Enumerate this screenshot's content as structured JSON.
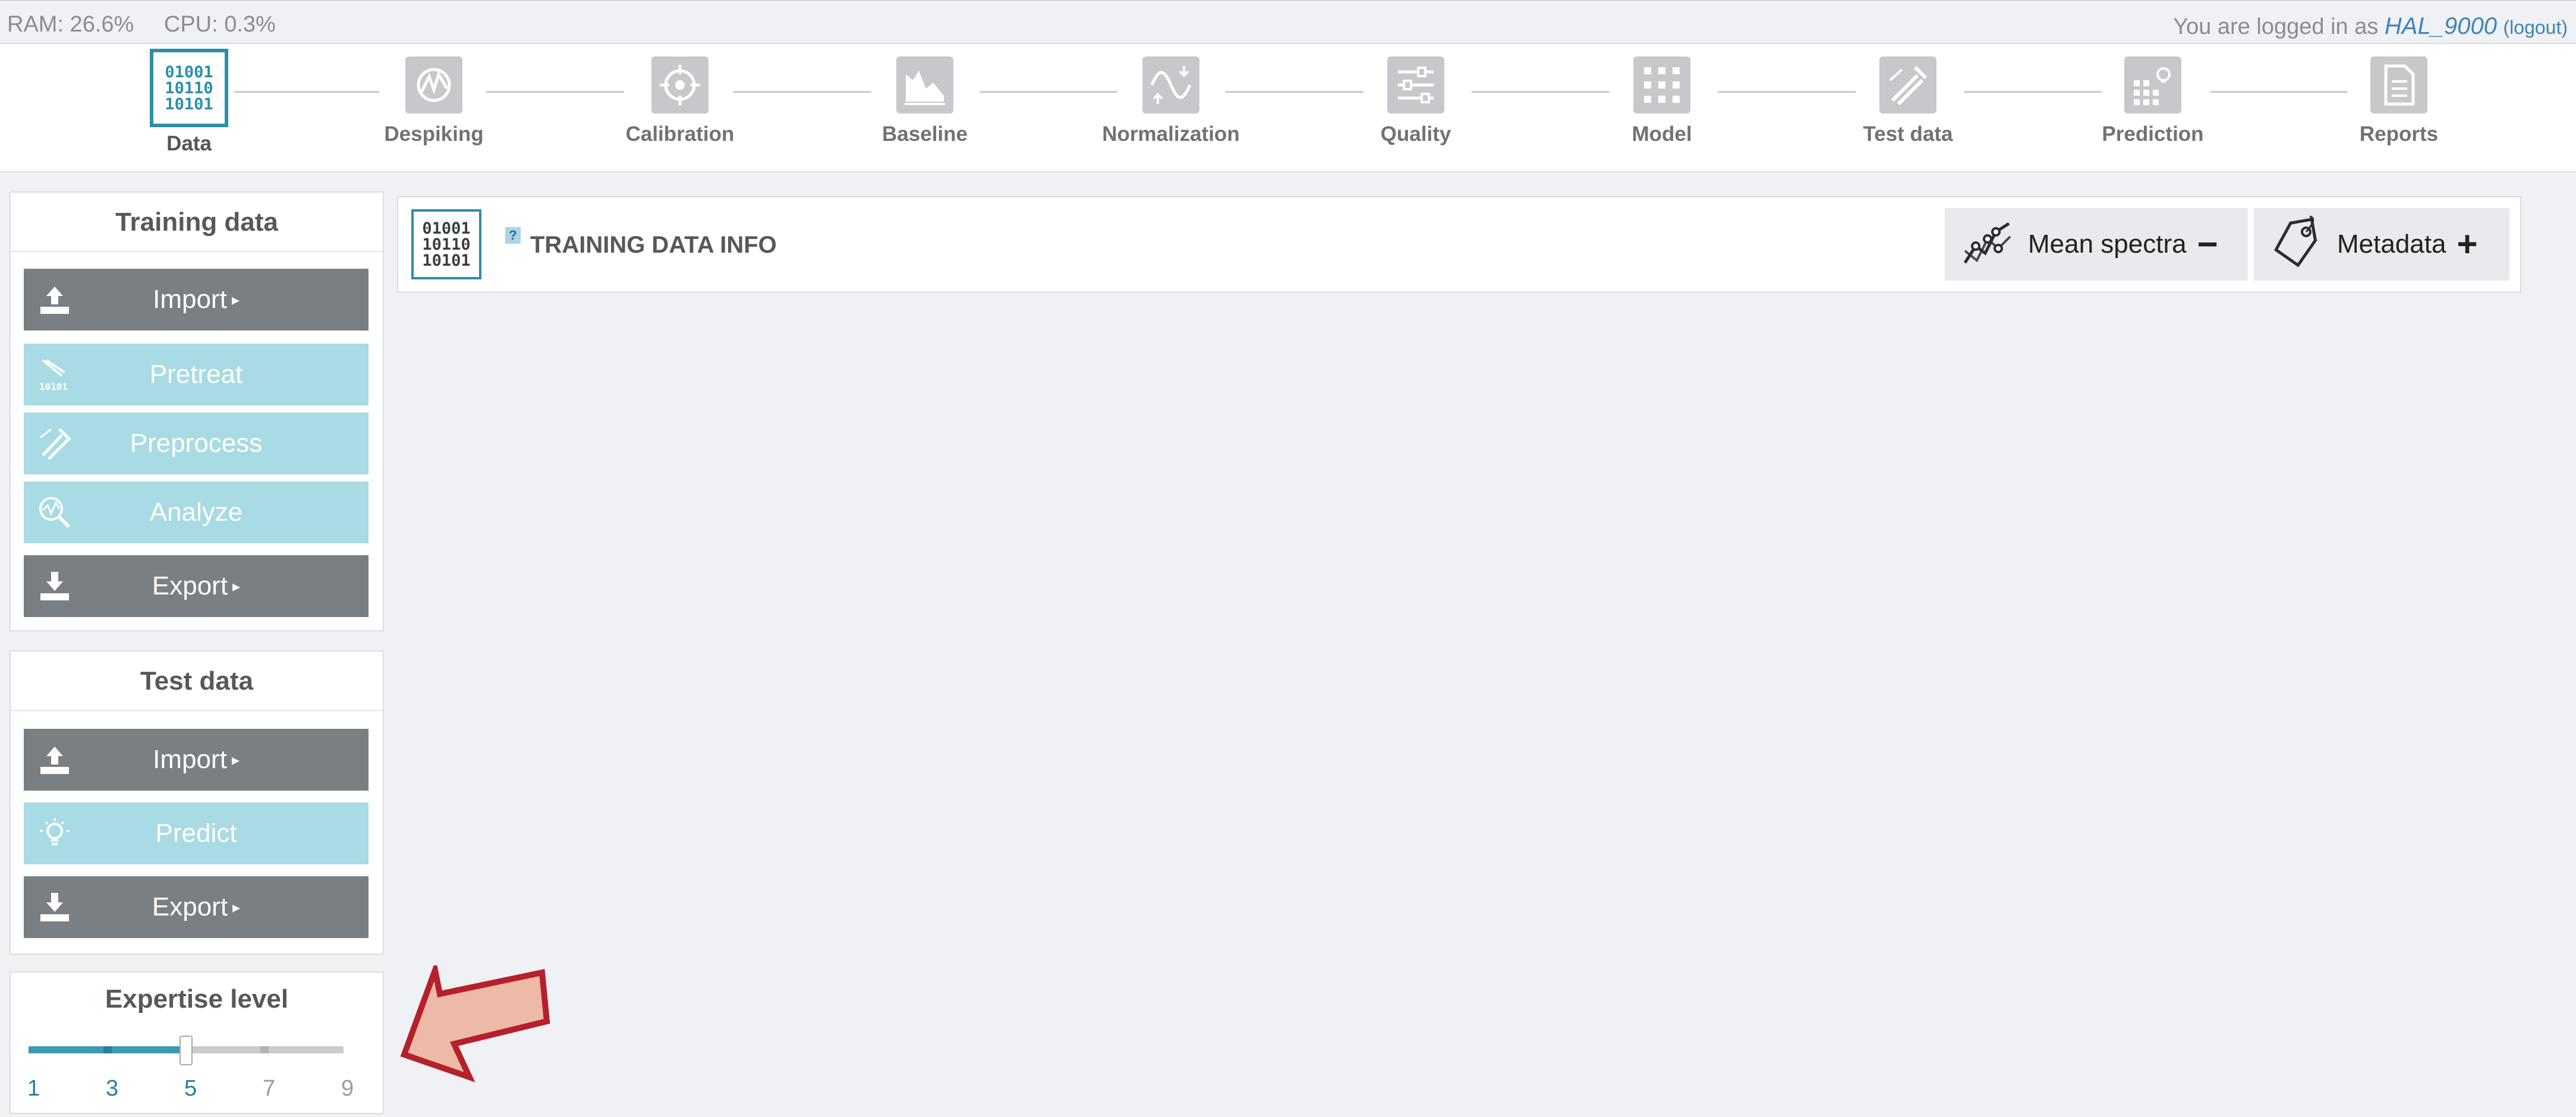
{
  "status": {
    "ram": "RAM: 26.6%",
    "cpu": "CPU: 0.3%",
    "logged_in_text": "You are logged in as ",
    "username": "HAL_9000",
    "logout": "(logout)"
  },
  "steps": [
    {
      "label": "Data",
      "active": true,
      "icon": "binary-data-icon"
    },
    {
      "label": "Despiking",
      "icon": "despiking-icon"
    },
    {
      "label": "Calibration",
      "icon": "crosshair-icon"
    },
    {
      "label": "Baseline",
      "icon": "baseline-icon"
    },
    {
      "label": "Normalization",
      "icon": "normalization-icon"
    },
    {
      "label": "Quality",
      "icon": "sliders-icon"
    },
    {
      "label": "Model",
      "icon": "grid-dots-icon"
    },
    {
      "label": "Test data",
      "icon": "test-tube-icon"
    },
    {
      "label": "Prediction",
      "icon": "prediction-icon"
    },
    {
      "label": "Reports",
      "icon": "document-icon"
    }
  ],
  "binary_text": "01001\n10110\n10101",
  "training": {
    "title": "Training data",
    "import": "Import",
    "pretreat": "Pretreat",
    "preprocess": "Preprocess",
    "analyze": "Analyze",
    "export": "Export"
  },
  "test": {
    "title": "Test data",
    "import": "Import",
    "predict": "Predict",
    "export": "Export"
  },
  "expertise": {
    "title": "Expertise level",
    "levels": [
      "1",
      "3",
      "5",
      "7",
      "9"
    ],
    "value": 5
  },
  "main": {
    "help": "?",
    "title": "TRAINING DATA INFO",
    "mean_spectra": "Mean spectra",
    "metadata": "Metadata",
    "mean_spectra_sign": "−",
    "metadata_sign": "+"
  },
  "colors": {
    "accent": "#2b8fa6",
    "dark_button": "#7a7f83",
    "light_button": "#a8dbe3",
    "arrow_fill": "#eebaa8",
    "arrow_stroke": "#b5202a"
  }
}
